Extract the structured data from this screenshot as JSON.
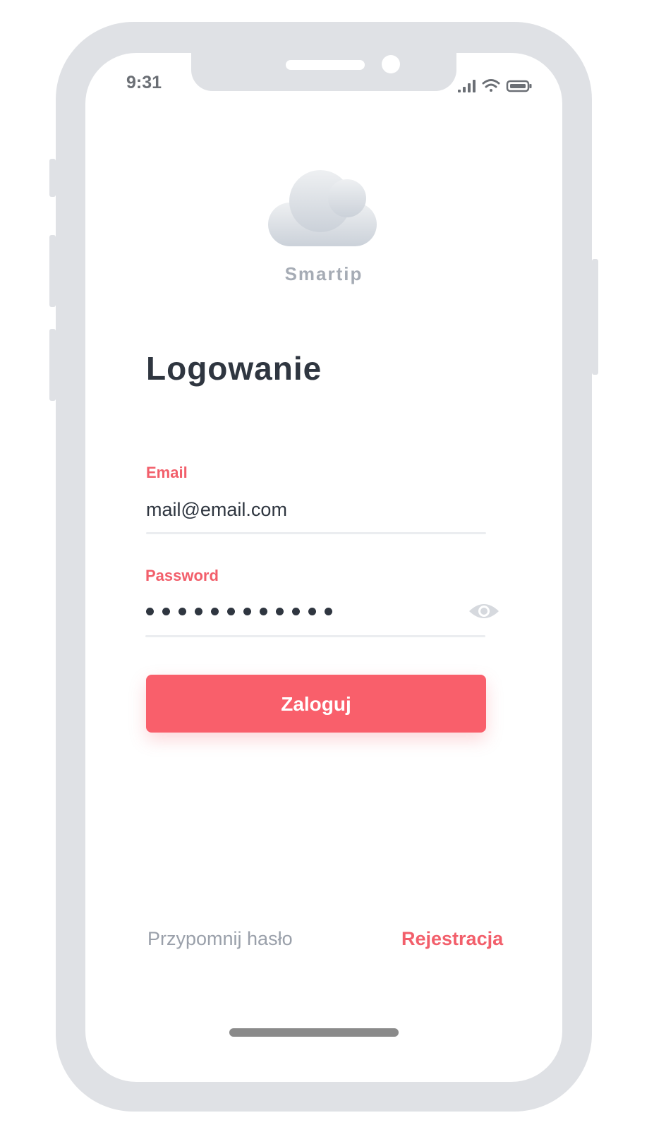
{
  "status_bar": {
    "time": "9:31",
    "signal_icon": "cellular-signal-icon",
    "wifi_icon": "wifi-icon",
    "battery_icon": "battery-icon"
  },
  "brand": {
    "logo_icon": "cloud-icon",
    "name": "Smartip"
  },
  "page": {
    "title": "Logowanie"
  },
  "form": {
    "email": {
      "label": "Email",
      "value": "mail@email.com"
    },
    "password": {
      "label": "Password",
      "masked_length": 12,
      "toggle_icon": "eye-icon"
    },
    "submit_label": "Zaloguj"
  },
  "footer": {
    "forgot_label": "Przypomnij hasło",
    "register_label": "Rejestracja"
  },
  "colors": {
    "accent": "#f95f6b",
    "label_accent": "#f25f6b",
    "text_dark": "#2f3640",
    "muted": "#9aa0aa",
    "device_frame": "#dfe1e5"
  }
}
